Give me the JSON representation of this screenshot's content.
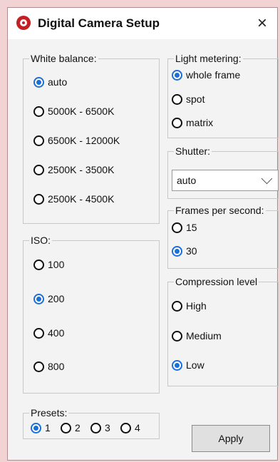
{
  "window": {
    "title": "Digital Camera Setup",
    "close_label": "×",
    "icon": "camera-lens-icon"
  },
  "white_balance": {
    "legend": "White balance:",
    "options": [
      "auto",
      "5000K - 6500K",
      "6500K - 12000K",
      "2500K - 3500K",
      "2500K - 4500K"
    ],
    "selected": "auto"
  },
  "iso": {
    "legend": "ISO:",
    "options": [
      "100",
      "200",
      "400",
      "800"
    ],
    "selected": "200"
  },
  "presets": {
    "legend": "Presets:",
    "options": [
      "1",
      "2",
      "3",
      "4"
    ],
    "selected": "1"
  },
  "light_metering": {
    "legend": "Light metering:",
    "options": [
      "whole frame",
      "spot",
      "matrix"
    ],
    "selected": "whole frame"
  },
  "shutter": {
    "legend": "Shutter:",
    "value": "auto"
  },
  "fps": {
    "legend": "Frames per second:",
    "options": [
      "15",
      "30"
    ],
    "selected": "30"
  },
  "compression": {
    "legend": "Compression level",
    "options": [
      "High",
      "Medium",
      "Low"
    ],
    "selected": "Low"
  },
  "actions": {
    "apply_label": "Apply"
  },
  "colors": {
    "accent": "#1d6fd8",
    "icon_red": "#c51f24",
    "background": "#f2d3d3"
  }
}
